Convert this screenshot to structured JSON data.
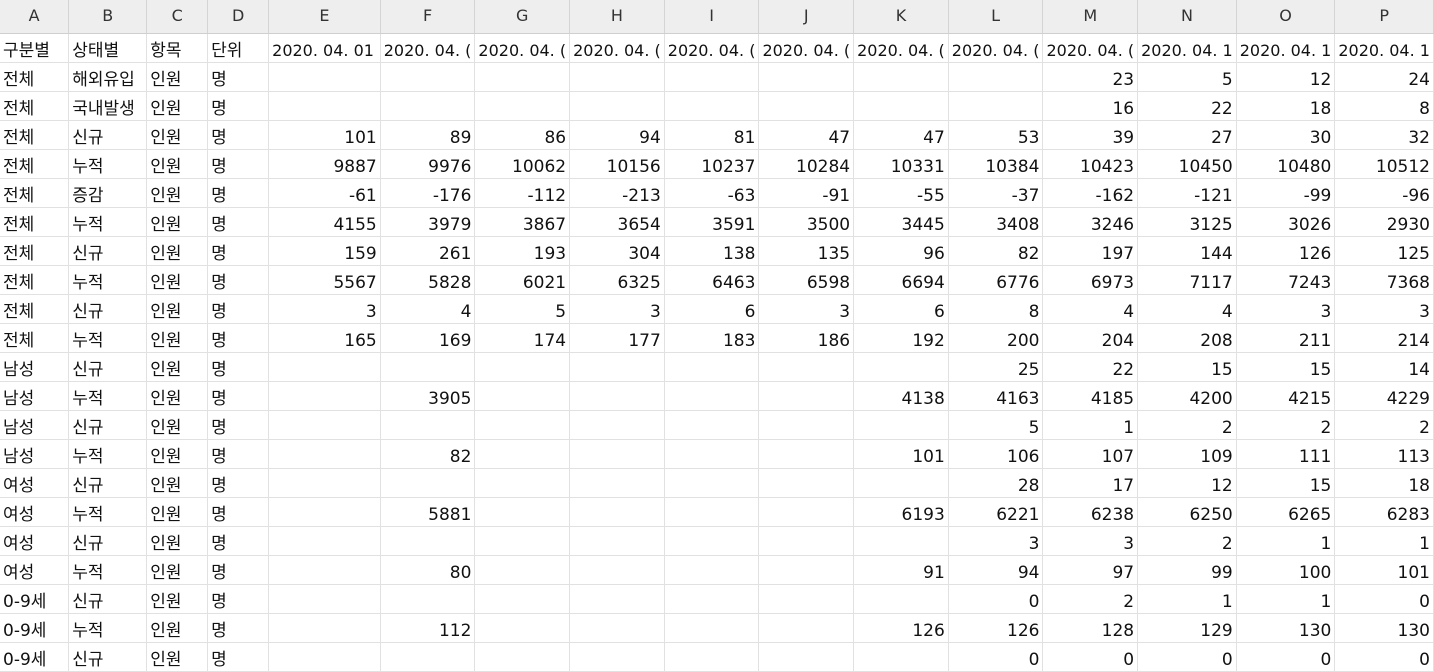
{
  "columns": [
    "A",
    "B",
    "C",
    "D",
    "E",
    "F",
    "G",
    "H",
    "I",
    "J",
    "K",
    "L",
    "M",
    "N",
    "O",
    "P"
  ],
  "header_row": [
    "구분별",
    "상태별",
    "항목",
    "단위",
    "2020. 04. 01",
    "2020. 04. (",
    "2020. 04. (",
    "2020. 04. (",
    "2020. 04. (",
    "2020. 04. (",
    "2020. 04. (",
    "2020. 04. (",
    "2020. 04. (",
    "2020. 04. 1",
    "2020. 04. 1",
    "2020. 04. 1"
  ],
  "rows": [
    [
      "전체",
      "해외유입",
      "인원",
      "명",
      "",
      "",
      "",
      "",
      "",
      "",
      "",
      "",
      "23",
      "5",
      "12",
      "24"
    ],
    [
      "전체",
      "국내발생",
      "인원",
      "명",
      "",
      "",
      "",
      "",
      "",
      "",
      "",
      "",
      "16",
      "22",
      "18",
      "8"
    ],
    [
      "전체",
      "신규",
      "인원",
      "명",
      "101",
      "89",
      "86",
      "94",
      "81",
      "47",
      "47",
      "53",
      "39",
      "27",
      "30",
      "32"
    ],
    [
      "전체",
      "누적",
      "인원",
      "명",
      "9887",
      "9976",
      "10062",
      "10156",
      "10237",
      "10284",
      "10331",
      "10384",
      "10423",
      "10450",
      "10480",
      "10512"
    ],
    [
      "전체",
      "증감",
      "인원",
      "명",
      "-61",
      "-176",
      "-112",
      "-213",
      "-63",
      "-91",
      "-55",
      "-37",
      "-162",
      "-121",
      "-99",
      "-96"
    ],
    [
      "전체",
      "누적",
      "인원",
      "명",
      "4155",
      "3979",
      "3867",
      "3654",
      "3591",
      "3500",
      "3445",
      "3408",
      "3246",
      "3125",
      "3026",
      "2930"
    ],
    [
      "전체",
      "신규",
      "인원",
      "명",
      "159",
      "261",
      "193",
      "304",
      "138",
      "135",
      "96",
      "82",
      "197",
      "144",
      "126",
      "125"
    ],
    [
      "전체",
      "누적",
      "인원",
      "명",
      "5567",
      "5828",
      "6021",
      "6325",
      "6463",
      "6598",
      "6694",
      "6776",
      "6973",
      "7117",
      "7243",
      "7368"
    ],
    [
      "전체",
      "신규",
      "인원",
      "명",
      "3",
      "4",
      "5",
      "3",
      "6",
      "3",
      "6",
      "8",
      "4",
      "4",
      "3",
      "3"
    ],
    [
      "전체",
      "누적",
      "인원",
      "명",
      "165",
      "169",
      "174",
      "177",
      "183",
      "186",
      "192",
      "200",
      "204",
      "208",
      "211",
      "214"
    ],
    [
      "남성",
      "신규",
      "인원",
      "명",
      "",
      "",
      "",
      "",
      "",
      "",
      "",
      "25",
      "22",
      "15",
      "15",
      "14"
    ],
    [
      "남성",
      "누적",
      "인원",
      "명",
      "",
      "3905",
      "",
      "",
      "",
      "",
      "4138",
      "4163",
      "4185",
      "4200",
      "4215",
      "4229"
    ],
    [
      "남성",
      "신규",
      "인원",
      "명",
      "",
      "",
      "",
      "",
      "",
      "",
      "",
      "5",
      "1",
      "2",
      "2",
      "2"
    ],
    [
      "남성",
      "누적",
      "인원",
      "명",
      "",
      "82",
      "",
      "",
      "",
      "",
      "101",
      "106",
      "107",
      "109",
      "111",
      "113"
    ],
    [
      "여성",
      "신규",
      "인원",
      "명",
      "",
      "",
      "",
      "",
      "",
      "",
      "",
      "28",
      "17",
      "12",
      "15",
      "18"
    ],
    [
      "여성",
      "누적",
      "인원",
      "명",
      "",
      "5881",
      "",
      "",
      "",
      "",
      "6193",
      "6221",
      "6238",
      "6250",
      "6265",
      "6283"
    ],
    [
      "여성",
      "신규",
      "인원",
      "명",
      "",
      "",
      "",
      "",
      "",
      "",
      "",
      "3",
      "3",
      "2",
      "1",
      "1"
    ],
    [
      "여성",
      "누적",
      "인원",
      "명",
      "",
      "80",
      "",
      "",
      "",
      "",
      "91",
      "94",
      "97",
      "99",
      "100",
      "101"
    ],
    [
      "0-9세",
      "신규",
      "인원",
      "명",
      "",
      "",
      "",
      "",
      "",
      "",
      "",
      "0",
      "2",
      "1",
      "1",
      "0"
    ],
    [
      "0-9세",
      "누적",
      "인원",
      "명",
      "",
      "112",
      "",
      "",
      "",
      "",
      "126",
      "126",
      "128",
      "129",
      "130",
      "130"
    ],
    [
      "0-9세",
      "신규",
      "인원",
      "명",
      "",
      "",
      "",
      "",
      "",
      "",
      "",
      "0",
      "0",
      "0",
      "0",
      "0"
    ]
  ]
}
